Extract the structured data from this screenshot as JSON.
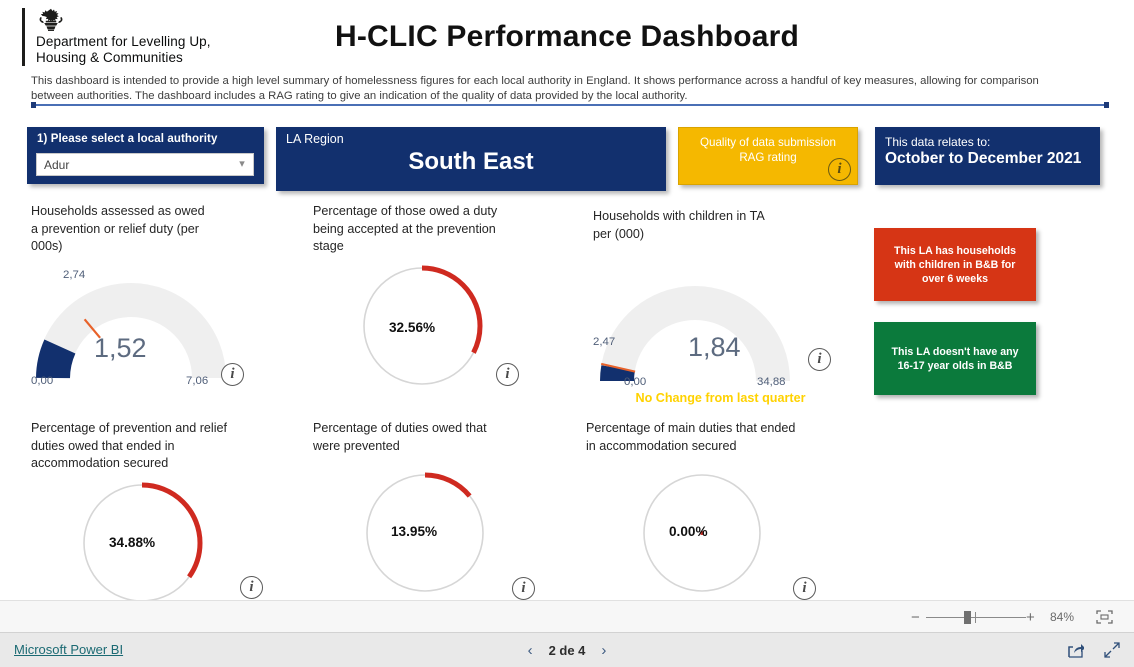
{
  "header": {
    "dept_line1": "Department for Levelling Up,",
    "dept_line2": "Housing & Communities",
    "crest_icon": "royal-crest-icon",
    "title": "H-CLIC Performance Dashboard",
    "intro": "This dashboard is intended to provide a high level summary of homelessness figures for each local authority in England. It shows performance across a handful of key measures, allowing for comparison between authorities. The dashboard includes a RAG rating to give an indication of the quality of data provided by the local authority."
  },
  "filters": {
    "la_select_label": "1) Please select a local authority",
    "la_select_value": "Adur",
    "la_select_placeholder": "Adur",
    "chevron_icon": "chevron-down-icon",
    "region_label": "LA Region",
    "region_value": "South East",
    "rag_line1": "Quality of data submission",
    "rag_line2": "RAG rating",
    "rag_info_icon": "info-icon",
    "period_label": "This data relates to:",
    "period_value": "October to December 2021"
  },
  "colors": {
    "navy": "#12306e",
    "amber": "#f5b800",
    "red": "#d63515",
    "green": "#0b7a3c",
    "arc_red": "#cf2a20",
    "target_orange": "#e8622a",
    "gauge_track": "#efefef",
    "yellow_text": "#ffd200"
  },
  "status_boxes": [
    {
      "name": "red-status",
      "text": "This LA has households with children in B&B for over 6 weeks",
      "color": "#d63515"
    },
    {
      "name": "green-status",
      "text": "This LA doesn't have any 16-17 year olds in B&B",
      "color": "#0b7a3c"
    }
  ],
  "chart_data": [
    {
      "type": "gauge",
      "name": "households-assessed-gauge",
      "title": "Households assessed as owed a prevention or relief duty (per 000s)",
      "value": 1.52,
      "value_label": "1,52",
      "min": 0.0,
      "min_label": "0,00",
      "max": 7.06,
      "max_label": "7,06",
      "target": 2.74,
      "target_label": "2,74",
      "arc_color": "#12306e",
      "track_color": "#efefef",
      "target_color": "#e8622a",
      "info_icon": "info-icon"
    },
    {
      "type": "donut",
      "name": "prevention-stage-donut",
      "title": "Percentage of those owed a duty being accepted at the prevention stage",
      "value": 32.56,
      "value_label": "32.56%",
      "max": 100,
      "arc_color": "#cf2a20",
      "track_color": "#d6d6d6",
      "info_icon": "info-icon"
    },
    {
      "type": "gauge",
      "name": "children-in-ta-gauge",
      "title": "Households with children in TA per (000)",
      "value": 1.84,
      "value_label": "1,84",
      "min": 0.0,
      "min_label": "0,00",
      "max": 34.88,
      "max_label": "34,88",
      "target": 2.47,
      "target_label": "2,47",
      "note": "No Change from last quarter",
      "arc_color": "#12306e",
      "track_color": "#efefef",
      "target_color": "#e8622a",
      "info_icon": "info-icon"
    },
    {
      "type": "donut",
      "name": "prevention-relief-accommodation-donut",
      "title": "Percentage of prevention and relief duties owed that ended in accommodation secured",
      "value": 34.88,
      "value_label": "34.88%",
      "max": 100,
      "arc_color": "#cf2a20",
      "track_color": "#d6d6d6",
      "info_icon": "info-icon"
    },
    {
      "type": "donut",
      "name": "duties-prevented-donut",
      "title": "Percentage of duties owed that were prevented",
      "value": 13.95,
      "value_label": "13.95%",
      "max": 100,
      "arc_color": "#cf2a20",
      "track_color": "#d6d6d6",
      "info_icon": "info-icon"
    },
    {
      "type": "donut",
      "name": "main-duties-accommodation-donut",
      "title": "Percentage of main duties that ended in accommodation secured",
      "value": 0.0,
      "value_label": "0.00%",
      "max": 100,
      "arc_color": "#cf2a20",
      "track_color": "#d6d6d6",
      "info_icon": "info-icon"
    }
  ],
  "zoombar": {
    "zoom_out_icon": "minus-icon",
    "zoom_in_icon": "plus-icon",
    "zoom_level": "84%",
    "fit_icon": "fit-to-page-icon"
  },
  "statusbar": {
    "brand_link": "Microsoft Power BI",
    "prev_icon": "chevron-left-icon",
    "page_indicator": "2 de 4",
    "next_icon": "chevron-right-icon",
    "share_icon": "share-icon",
    "fullscreen_icon": "fullscreen-icon"
  }
}
